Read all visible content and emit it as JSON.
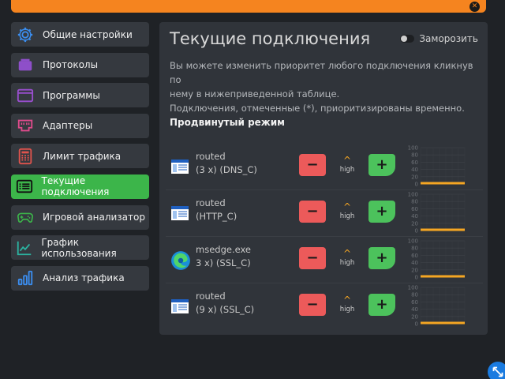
{
  "window": {
    "close_glyph": "✕"
  },
  "sidebar": {
    "items": [
      {
        "label": "Общие настройки",
        "icon": "gear-icon",
        "active": false
      },
      {
        "label": "Протоколы",
        "icon": "protocols-icon",
        "active": false
      },
      {
        "label": "Программы",
        "icon": "window-icon",
        "active": false
      },
      {
        "label": "Адаптеры",
        "icon": "ethernet-icon",
        "active": false
      },
      {
        "label": "Лимит трафика",
        "icon": "calculator-icon",
        "active": false
      },
      {
        "label": "Текущие подключения",
        "icon": "connections-list-icon",
        "active": true
      },
      {
        "label": "Игровой анализатор",
        "icon": "gamepad-icon",
        "active": false
      },
      {
        "label": "График использования",
        "icon": "line-chart-icon",
        "active": false
      },
      {
        "label": "Анализ трафика",
        "icon": "bar-chart-icon",
        "active": false
      }
    ]
  },
  "main": {
    "title": "Текущие подключения",
    "freeze_label": "Заморозить",
    "description_line1": "Вы можете изменить приоритет любого подключения кликнув по",
    "description_line2": "нему в нижеприведенной таблице.",
    "description_line3": "Подключения, отмеченные (*), приоритизированы временно.",
    "mode_label": "Продвинутый режим"
  },
  "connections": [
    {
      "name": "routed",
      "detail": "(3 x) (DNS_C)",
      "icon": "app-window-icon",
      "priority": "high",
      "minus": "−",
      "plus": "+",
      "arrow": "^",
      "usage": 0
    },
    {
      "name": "routed",
      "detail": "(HTTP_C)",
      "icon": "app-window-icon",
      "priority": "high",
      "minus": "−",
      "plus": "+",
      "arrow": "^",
      "usage": 0
    },
    {
      "name": "msedge.exe",
      "detail": "3 x) (SSL_C)",
      "icon": "edge-browser-icon",
      "priority": "high",
      "minus": "−",
      "plus": "+",
      "arrow": "^",
      "usage": 0
    },
    {
      "name": "routed",
      "detail": "(9 x) (SSL_C)",
      "icon": "app-window-icon",
      "priority": "high",
      "minus": "−",
      "plus": "+",
      "arrow": "^",
      "usage": 0
    }
  ],
  "sparkline_ticks": [
    "100",
    "80",
    "60",
    "40",
    "20",
    "0"
  ],
  "colors": {
    "accent": "#f5841f",
    "active": "#3cb54a",
    "minus": "#ec5a5a",
    "plus": "#4cc25c",
    "spark": "#f5a623"
  }
}
